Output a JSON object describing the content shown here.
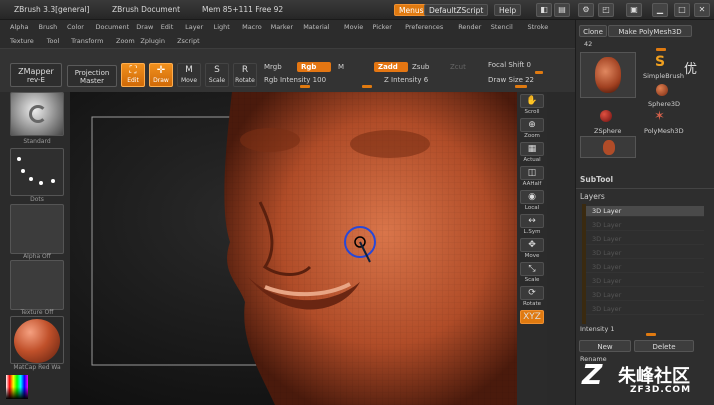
{
  "titlebar": {
    "app": "ZBrush 3.3[general]",
    "doc": "ZBrush Document",
    "mem": "Mem 85+111 Free 92",
    "menus": "Menus",
    "script": "DefaultZScript",
    "help": "Help"
  },
  "menubar": {
    "row1": [
      "Alpha",
      "Brush",
      "Color",
      "Document",
      "Draw",
      "Edit",
      "Layer",
      "Light",
      "Macro",
      "Marker",
      "Material",
      "Movie",
      "Picker",
      "Preferences",
      "Render",
      "Stencil",
      "Stroke"
    ],
    "row2": [
      "Texture",
      "Tool",
      "Transform",
      "Zoom",
      "Zplugin",
      "Zscript"
    ]
  },
  "shelf": {
    "zmapper": "ZMapper",
    "zmapper_sub": "rev-E",
    "projection": "Projection",
    "projection_sub": "Master",
    "edit": "Edit",
    "draw": "Draw",
    "move": "Move",
    "scale": "Scale",
    "rotate": "Rotate",
    "mrgb": "Mrgb",
    "rgb": "Rgb",
    "m": "M",
    "rgb_intensity": "Rgb Intensity 100",
    "zadd": "Zadd",
    "zsub": "Zsub",
    "zcut": "Zcut",
    "z_intensity": "Z Intensity 6",
    "focal_shift": "Focal Shift 0",
    "draw_size": "Draw Size 22"
  },
  "lefttray": {
    "tiles": [
      "Standard",
      "Dots",
      "Alpha Off",
      "Texture Off",
      "MatCap Red Wa"
    ]
  },
  "rightstrip": {
    "buttons": [
      "Scroll",
      "Zoom",
      "Actual",
      "AAHalf",
      "Local",
      "L.Sym",
      "Move",
      "Scale",
      "Rotate",
      "XYZ"
    ]
  },
  "rightpanel": {
    "clone": "Clone",
    "make": "Make PolyMesh3D",
    "value": "42",
    "tools": [
      "SimpleBrush",
      "Sphere3D",
      "ZSphere",
      "PolyMesh3D"
    ],
    "subtool": "SubTool",
    "layers": "Layers",
    "layer_rows": [
      "3D Layer",
      "3D Layer",
      "3D Layer",
      "3D Layer",
      "3D Layer",
      "3D Layer",
      "3D Layer",
      "3D Layer"
    ],
    "intensity": "Intensity 1",
    "new": "New",
    "delete": "Delete",
    "rename": "Rename"
  },
  "watermark": {
    "logo": "Z",
    "text": "朱峰社区",
    "url": "ZF3D.COM",
    "corner": "优"
  },
  "colors": {
    "accent": "#e07a10",
    "skin": "#b8542e",
    "brush_ring": "#3050d0"
  }
}
